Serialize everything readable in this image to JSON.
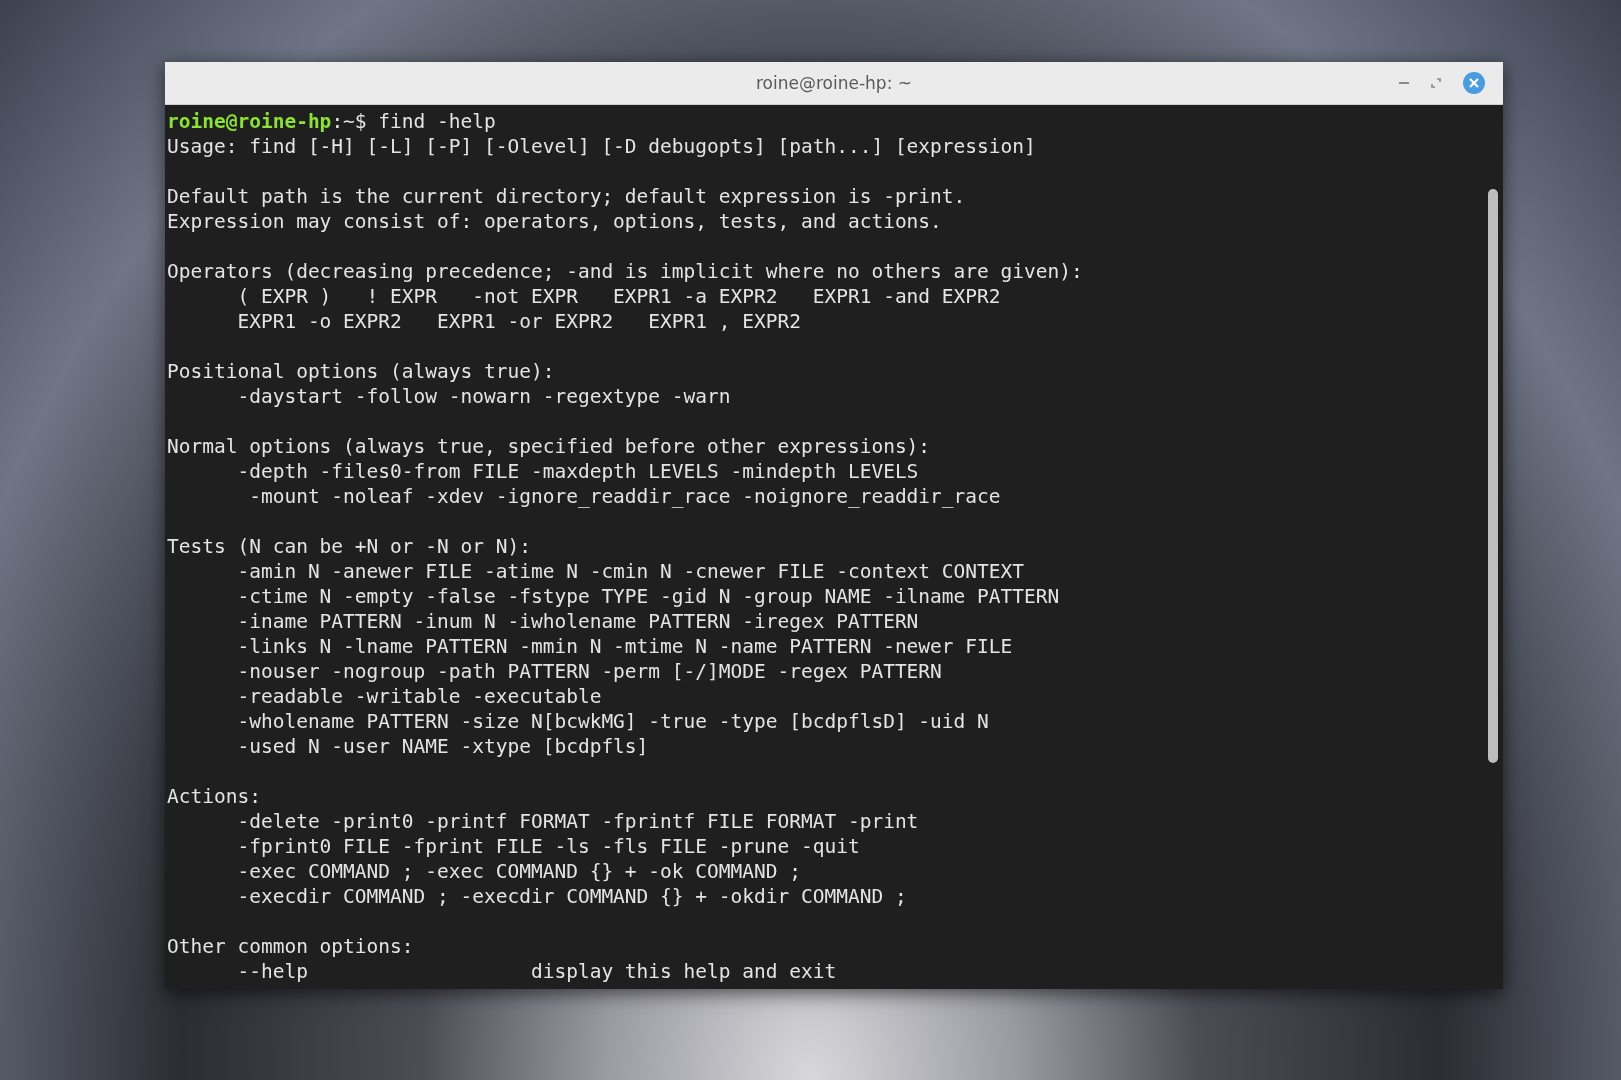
{
  "window": {
    "title": "roine@roine-hp: ~"
  },
  "terminal": {
    "prompt": {
      "user_host": "roine@roine-hp",
      "rest": ":~$ find -help"
    },
    "blocks": [
      [
        "Usage: find [-H] [-L] [-P] [-Olevel] [-D debugopts] [path...] [expression]"
      ],
      [
        "Default path is the current directory; default expression is -print.",
        "Expression may consist of: operators, options, tests, and actions."
      ],
      [
        "Operators (decreasing precedence; -and is implicit where no others are given):",
        "      ( EXPR )   ! EXPR   -not EXPR   EXPR1 -a EXPR2   EXPR1 -and EXPR2",
        "      EXPR1 -o EXPR2   EXPR1 -or EXPR2   EXPR1 , EXPR2"
      ],
      [
        "Positional options (always true):",
        "      -daystart -follow -nowarn -regextype -warn"
      ],
      [
        "Normal options (always true, specified before other expressions):",
        "      -depth -files0-from FILE -maxdepth LEVELS -mindepth LEVELS",
        "       -mount -noleaf -xdev -ignore_readdir_race -noignore_readdir_race"
      ],
      [
        "Tests (N can be +N or -N or N):",
        "      -amin N -anewer FILE -atime N -cmin N -cnewer FILE -context CONTEXT",
        "      -ctime N -empty -false -fstype TYPE -gid N -group NAME -ilname PATTERN",
        "      -iname PATTERN -inum N -iwholename PATTERN -iregex PATTERN",
        "      -links N -lname PATTERN -mmin N -mtime N -name PATTERN -newer FILE",
        "      -nouser -nogroup -path PATTERN -perm [-/]MODE -regex PATTERN",
        "      -readable -writable -executable",
        "      -wholename PATTERN -size N[bcwkMG] -true -type [bcdpflsD] -uid N",
        "      -used N -user NAME -xtype [bcdpfls]"
      ],
      [
        "Actions:",
        "      -delete -print0 -printf FORMAT -fprintf FILE FORMAT -print",
        "      -fprint0 FILE -fprint FILE -ls -fls FILE -prune -quit",
        "      -exec COMMAND ; -exec COMMAND {} + -ok COMMAND ;",
        "      -execdir COMMAND ; -execdir COMMAND {} + -okdir COMMAND ;"
      ],
      [
        "Other common options:",
        "      --help                   display this help and exit"
      ]
    ]
  }
}
